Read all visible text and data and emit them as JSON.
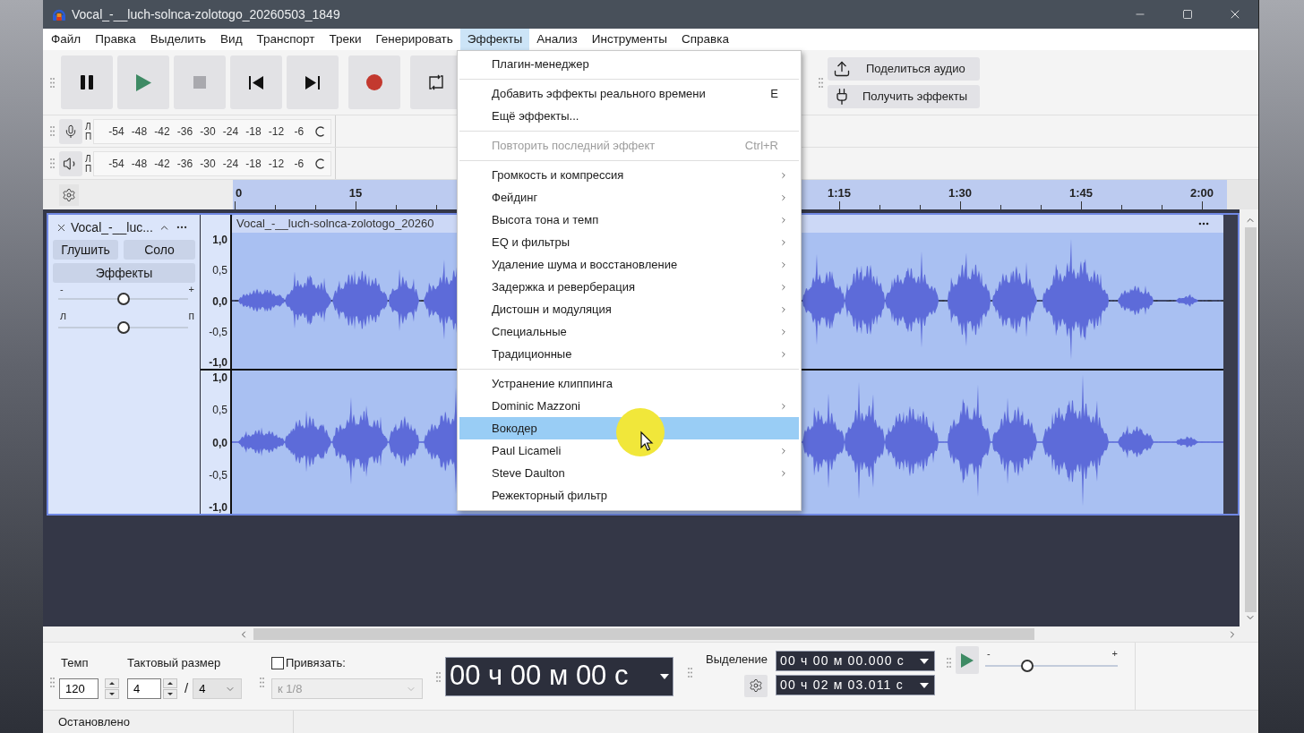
{
  "window": {
    "title": "Vocal_-__luch-solnca-zolotogo_20260503_1849"
  },
  "menu_bar": [
    {
      "label": "Файл",
      "selected": false
    },
    {
      "label": "Правка",
      "selected": false
    },
    {
      "label": "Выделить",
      "selected": false
    },
    {
      "label": "Вид",
      "selected": false
    },
    {
      "label": "Транспорт",
      "selected": false
    },
    {
      "label": "Треки",
      "selected": false
    },
    {
      "label": "Генерировать",
      "selected": false
    },
    {
      "label": "Эффекты",
      "selected": true
    },
    {
      "label": "Анализ",
      "selected": false
    },
    {
      "label": "Инструменты",
      "selected": false
    },
    {
      "label": "Справка",
      "selected": false
    }
  ],
  "share_buttons": [
    {
      "kind": "share",
      "label": "Поделиться аудио"
    },
    {
      "kind": "plugins",
      "label": "Получить эффекты"
    }
  ],
  "meters": [
    {
      "kind": "record",
      "channels": [
        "Л",
        "П"
      ],
      "scale": [
        "-54",
        "-48",
        "-42",
        "-36",
        "-30",
        "-24",
        "-18",
        "-12",
        "-6"
      ]
    },
    {
      "kind": "playback",
      "channels": [
        "Л",
        "П"
      ],
      "scale": [
        "-54",
        "-48",
        "-42",
        "-36",
        "-30",
        "-24",
        "-18",
        "-12",
        "-6"
      ]
    }
  ],
  "ruler": {
    "start_labels": [
      "0",
      "15"
    ],
    "end_labels": [
      "1:15",
      "1:30",
      "1:45",
      "2:00"
    ]
  },
  "track": {
    "name": "Vocal_-__luc...",
    "buttons": [
      "Глушить",
      "Соло"
    ],
    "effects_button": "Эффекты",
    "gain": {
      "min_label": "-",
      "max_label": "+",
      "level": 0.5
    },
    "pan": {
      "min_label": "л",
      "max_label": "п",
      "level": 0.5
    },
    "channels": [
      {
        "scale": [
          "1,0",
          "0,5",
          "0,0",
          "-0,5",
          "-1,0"
        ]
      },
      {
        "scale": [
          "1,0",
          "0,5",
          "0,0",
          "-0,5",
          "-1,0"
        ]
      }
    ],
    "clip": {
      "title": "Vocal_-__luch-solnca-zolotogo_20260"
    }
  },
  "effects_menu": {
    "items": [
      {
        "kind": "command",
        "label": "Плагин-менеджер",
        "disabled": false,
        "selected": false
      },
      {
        "kind": "separator"
      },
      {
        "kind": "command",
        "label": "Добавить эффекты реального времени",
        "shortcut": "E",
        "disabled": false,
        "selected": false
      },
      {
        "kind": "command",
        "label": "Ещё эффекты...",
        "disabled": false,
        "selected": false
      },
      {
        "kind": "separator"
      },
      {
        "kind": "command",
        "label": "Повторить последний эффект",
        "shortcut": "Ctrl+R",
        "disabled": true,
        "selected": false
      },
      {
        "kind": "separator"
      },
      {
        "kind": "submenu",
        "label": "Громкость и компрессия",
        "disabled": false,
        "selected": false
      },
      {
        "kind": "submenu",
        "label": "Фейдинг",
        "disabled": false,
        "selected": false
      },
      {
        "kind": "submenu",
        "label": "Высота тона и темп",
        "disabled": false,
        "selected": false
      },
      {
        "kind": "submenu",
        "label": "EQ и фильтры",
        "disabled": false,
        "selected": false
      },
      {
        "kind": "submenu",
        "label": "Удаление шума и восстановление",
        "disabled": false,
        "selected": false
      },
      {
        "kind": "submenu",
        "label": "Задержка и реверберация",
        "disabled": false,
        "selected": false
      },
      {
        "kind": "submenu",
        "label": "Дистошн и модуляция",
        "disabled": false,
        "selected": false
      },
      {
        "kind": "submenu",
        "label": "Специальные",
        "disabled": false,
        "selected": false
      },
      {
        "kind": "submenu",
        "label": "Традиционные",
        "disabled": false,
        "selected": false
      },
      {
        "kind": "separator"
      },
      {
        "kind": "command",
        "label": "Устранение клиппинга",
        "disabled": false,
        "selected": false
      },
      {
        "kind": "submenu",
        "label": "Dominic Mazzoni",
        "disabled": false,
        "selected": false
      },
      {
        "kind": "command",
        "label": "Вокодер",
        "disabled": false,
        "selected": true
      },
      {
        "kind": "submenu",
        "label": "Paul Licameli",
        "disabled": false,
        "selected": false
      },
      {
        "kind": "submenu",
        "label": "Steve Daulton",
        "disabled": false,
        "selected": false
      },
      {
        "kind": "command",
        "label": "Режекторный фильтр",
        "disabled": false,
        "selected": false
      }
    ]
  },
  "bottom_toolbar": {
    "tempo": {
      "label": "Темп",
      "value": "120"
    },
    "time_signature": {
      "label": "Тактовый размер",
      "numerator": "4",
      "separator": "/",
      "denominator": "4"
    },
    "snap": {
      "label": "Привязать:",
      "checked": false,
      "value": "к 1/8",
      "disabled": true
    },
    "time_display": "00 ч 00 м 00 с",
    "selection": {
      "label": "Выделение",
      "start": "00 ч 00 м 00.000 с",
      "end": "00 ч 02 м 03.011 с"
    },
    "play_at_speed": {
      "min_label": "-",
      "max_label": "+",
      "level": 0.32
    }
  },
  "status_bar": {
    "text": "Остановлено"
  }
}
